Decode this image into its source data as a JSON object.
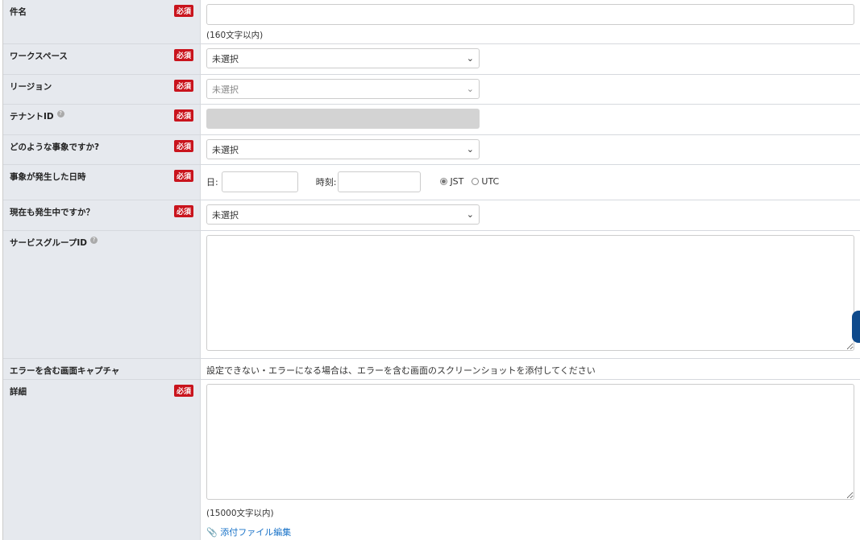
{
  "required_label": "必須",
  "fields": [
    {
      "label": "件名",
      "note": "(160文字以内)",
      "value": ""
    },
    {
      "label": "ワークスペース",
      "select": "未選択"
    },
    {
      "label": "リージョン",
      "select": "未選択"
    },
    {
      "label": "テナントID",
      "help": "?"
    },
    {
      "label": "どのような事象ですか?",
      "select": "未選択"
    },
    {
      "label": "事象が発生した日時",
      "date_label": "日:",
      "time_label": "時刻:",
      "tz_options": [
        "JST",
        "UTC"
      ],
      "tz_selected": "JST"
    },
    {
      "label": "現在も発生中ですか？",
      "select": "未選択"
    },
    {
      "label": "サービスグループID",
      "help": "?"
    },
    {
      "label": "エラーを含む画面キャプチャ",
      "text": "設定できない・エラーになる場合は、エラーを含む画面のスクリーンショットを添付してください"
    },
    {
      "label": "詳細",
      "note": "(15000文字以内)",
      "attach": "添付ファイル編集"
    }
  ],
  "colors": {
    "badge": "#c9141d",
    "link": "#1a73c8",
    "side_tab": "#0e4a8c"
  }
}
